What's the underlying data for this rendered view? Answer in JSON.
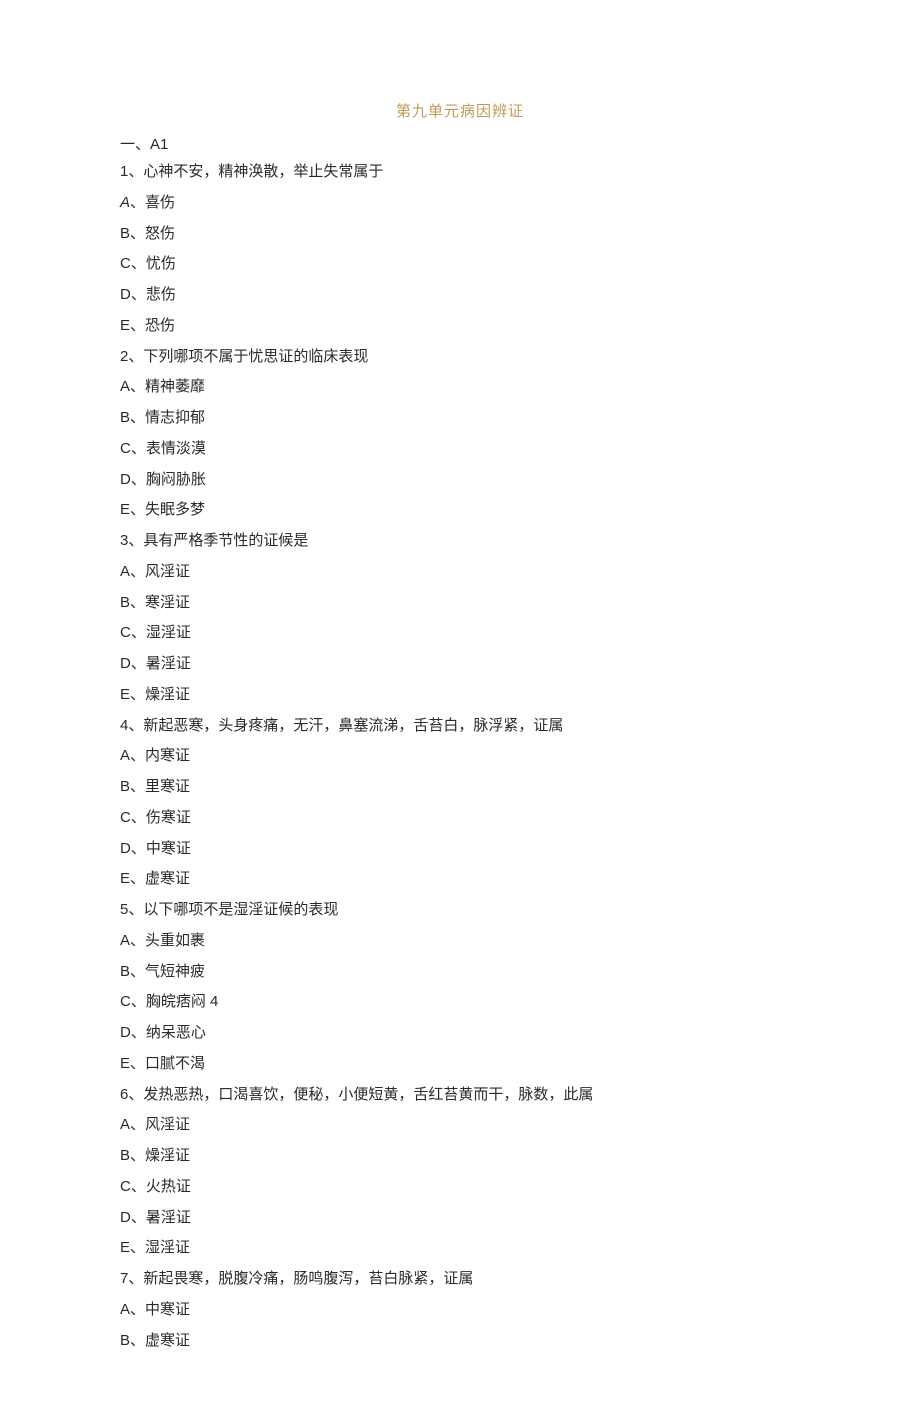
{
  "title": "第九单元病因辨证",
  "section_heading": "一、A1",
  "questions": [
    {
      "number": "1",
      "stem": "心神不安，精神涣散，举止失常属于",
      "options": [
        {
          "letter": "A",
          "text": "喜伤",
          "italic": true
        },
        {
          "letter": "B",
          "text": "怒伤"
        },
        {
          "letter": "C",
          "text": "忧伤"
        },
        {
          "letter": "D",
          "text": "悲伤"
        },
        {
          "letter": "E",
          "text": "恐伤"
        }
      ]
    },
    {
      "number": "2",
      "stem": "下列哪项不属于忧思证的临床表现",
      "options": [
        {
          "letter": "A",
          "text": "精神萎靡"
        },
        {
          "letter": "B",
          "text": "情志抑郁"
        },
        {
          "letter": "C",
          "text": "表情淡漠"
        },
        {
          "letter": "D",
          "text": "胸闷胁胀"
        },
        {
          "letter": "E",
          "text": "失眠多梦"
        }
      ]
    },
    {
      "number": "3",
      "stem": "具有严格季节性的证候是",
      "options": [
        {
          "letter": "A",
          "text": "风淫证"
        },
        {
          "letter": "B",
          "text": "寒淫证"
        },
        {
          "letter": "C",
          "text": "湿淫证"
        },
        {
          "letter": "D",
          "text": "暑淫证"
        },
        {
          "letter": "E",
          "text": "燥淫证"
        }
      ]
    },
    {
      "number": "4",
      "stem": "新起恶寒，头身疼痛，无汗，鼻塞流涕，舌苔白，脉浮紧，证属",
      "options": [
        {
          "letter": "A",
          "text": "内寒证"
        },
        {
          "letter": "B",
          "text": "里寒证"
        },
        {
          "letter": "C",
          "text": "伤寒证"
        },
        {
          "letter": "D",
          "text": "中寒证"
        },
        {
          "letter": "E",
          "text": "虚寒证"
        }
      ]
    },
    {
      "number": "5",
      "stem": "以下哪项不是湿淫证候的表现",
      "options": [
        {
          "letter": "A",
          "text": "头重如裹"
        },
        {
          "letter": "B",
          "text": "气短神疲"
        },
        {
          "letter": "C",
          "text": "胸皖痞闷 4"
        },
        {
          "letter": "D",
          "text": "纳呆恶心"
        },
        {
          "letter": "E",
          "text": "口腻不渴"
        }
      ]
    },
    {
      "number": "6",
      "stem": "发热恶热，口渴喜饮，便秘，小便短黄，舌红苔黄而干，脉数，此属",
      "options": [
        {
          "letter": "A",
          "text": "风淫证"
        },
        {
          "letter": "B",
          "text": "燥淫证"
        },
        {
          "letter": "C",
          "text": "火热证"
        },
        {
          "letter": "D",
          "text": "暑淫证"
        },
        {
          "letter": "E",
          "text": "湿淫证"
        }
      ]
    },
    {
      "number": "7",
      "stem": "新起畏寒，脱腹冷痛，肠鸣腹泻，苔白脉紧，证属",
      "options": [
        {
          "letter": "A",
          "text": "中寒证"
        },
        {
          "letter": "B",
          "text": "虚寒证"
        }
      ]
    }
  ]
}
